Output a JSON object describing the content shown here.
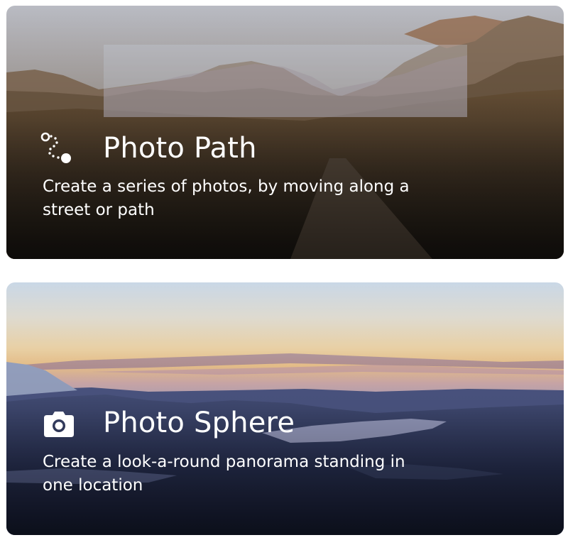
{
  "cards": [
    {
      "title": "Photo Path",
      "description": "Create a series of photos, by moving along a street or path",
      "icon": "photo-path-icon",
      "background": "desert-mountain-road-photo"
    },
    {
      "title": "Photo Sphere",
      "description": "Create a look-a-round panorama standing in one location",
      "icon": "camera-icon",
      "background": "sunset-lake-panorama-photo"
    }
  ],
  "colors": {
    "text": "#ffffff",
    "page_background": "#ffffff"
  }
}
